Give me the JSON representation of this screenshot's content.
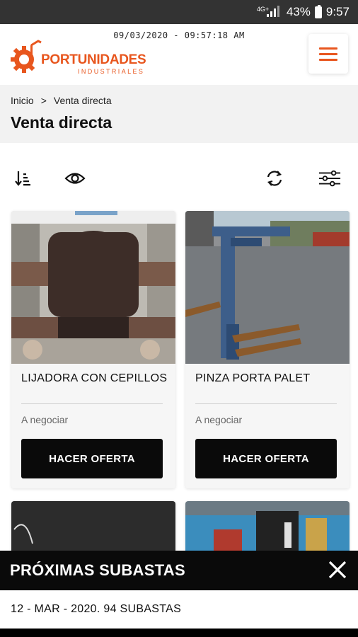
{
  "statusbar": {
    "network": "4G+",
    "battery_pct": "43%",
    "time": "9:57"
  },
  "header": {
    "datetime": "09/03/2020 - 09:57:18 AM",
    "logo_text": "PORTUNIDADES",
    "logo_sub": "INDUSTRIALES",
    "brand_color": "#e8561e",
    "menu_icon": "hamburger-icon"
  },
  "breadcrumb": {
    "home": "Inicio",
    "separator": ">",
    "current": "Venta directa"
  },
  "page": {
    "title": "Venta directa"
  },
  "toolbar": {
    "icons": [
      "sort-icon",
      "eye-icon",
      "refresh-icon",
      "filter-icon"
    ]
  },
  "products": [
    {
      "title": "LIJADORA CON CEPILLOS",
      "price": "A negociar",
      "button": "HACER OFERTA"
    },
    {
      "title": "PINZA PORTA PALET",
      "price": "A negociar",
      "button": "HACER OFERTA"
    }
  ],
  "auctions": {
    "title": "PRÓXIMAS SUBASTAS",
    "info": "12 - MAR - 2020. 94 SUBASTAS"
  }
}
